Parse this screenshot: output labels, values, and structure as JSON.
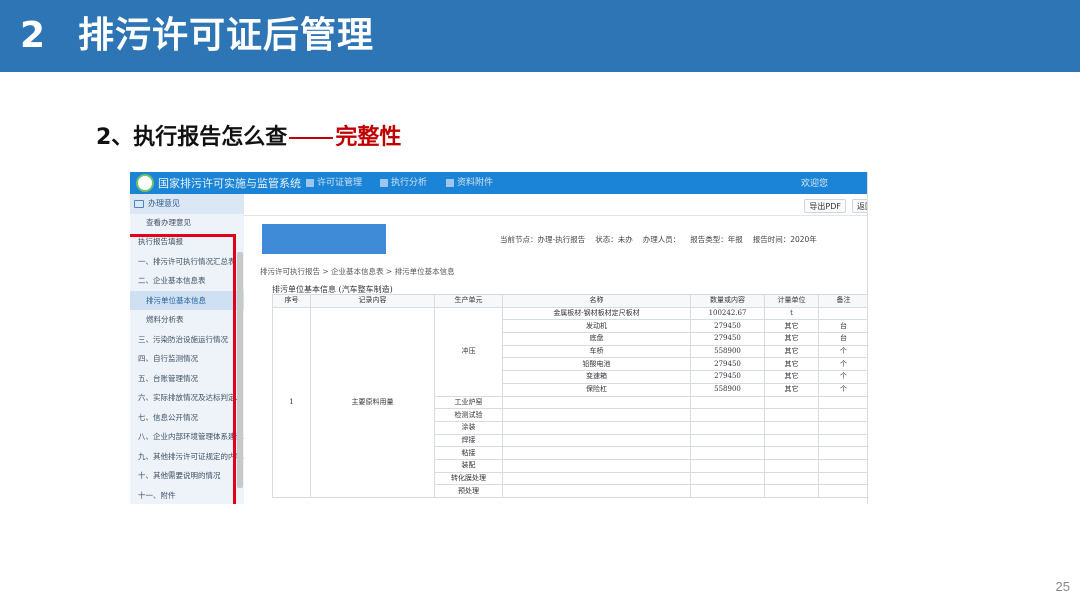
{
  "slide": {
    "section_number": "2",
    "section_title": "排污许可证后管理",
    "subtitle_main": "2、执行报告怎么查",
    "subtitle_accent": "完整性",
    "page_number": "25",
    "colors": {
      "title_bar": "#2e75b6",
      "accent": "#c00000",
      "highlight_box": "#e0001a"
    }
  },
  "app": {
    "system_name": "国家排污许可实施与监管系统",
    "nav_tabs": [
      "许可证管理",
      "执行分析",
      "资料附件"
    ],
    "nav_user": "欢迎您",
    "sidebar": {
      "header": "办理意见",
      "items": [
        {
          "label": "查看办理意见",
          "level": 1
        },
        {
          "label": "执行报告填报",
          "level": 0
        },
        {
          "label": "一、排污许可执行情况汇总表",
          "level": 1
        },
        {
          "label": "二、企业基本信息表",
          "level": 1
        },
        {
          "label": "排污单位基本信息",
          "level": 2,
          "active": true
        },
        {
          "label": "燃料分析表",
          "level": 2
        },
        {
          "label": "三、污染防治设施运行情况",
          "level": 1
        },
        {
          "label": "四、自行监测情况",
          "level": 1
        },
        {
          "label": "五、台账管理情况",
          "level": 1
        },
        {
          "label": "六、实际排放情况及达标判定...",
          "level": 1
        },
        {
          "label": "七、信息公开情况",
          "level": 1
        },
        {
          "label": "八、企业内部环境管理体系建设...",
          "level": 1
        },
        {
          "label": "九、其他排污许可证规定的内容...",
          "level": 1
        },
        {
          "label": "十、其他需要说明的情况",
          "level": 1
        },
        {
          "label": "十一、附件",
          "level": 1
        }
      ]
    },
    "toolbar": {
      "export_pdf": "导出PDF",
      "back": "返回"
    },
    "status": {
      "current_node": "当前节点：办理-执行报告",
      "state": "状态：未办",
      "handler": "办理人员：",
      "report_type": "报告类型：年报",
      "report_period": "报告时间：2020年"
    },
    "breadcrumb": "排污许可执行报告 > 企业基本信息表 > 排污单位基本信息",
    "table_title": "排污单位基本信息 (汽车整车制造)",
    "table": {
      "headers": [
        "序号",
        "记录内容",
        "生产单元",
        "名称",
        "数量或内容",
        "计量单位",
        "备注"
      ],
      "seq": "1",
      "record": "主要原料用量",
      "stamping_unit": "冲压",
      "stamping_rows": [
        [
          "金属板材-钢材板材定尺板材",
          "100242.67",
          "t",
          ""
        ],
        [
          "发动机",
          "279450",
          "其它",
          "台"
        ],
        [
          "底盘",
          "279450",
          "其它",
          "台"
        ],
        [
          "车桥",
          "558900",
          "其它",
          "个"
        ],
        [
          "铅酸电池",
          "279450",
          "其它",
          "个"
        ],
        [
          "变速箱",
          "279450",
          "其它",
          "个"
        ],
        [
          "保险杠",
          "558900",
          "其它",
          "个"
        ]
      ],
      "other_units": [
        "工业炉窑",
        "检测试验",
        "涂装",
        "焊接",
        "粘接",
        "装配",
        "转化膜处理",
        "预处理"
      ]
    }
  }
}
